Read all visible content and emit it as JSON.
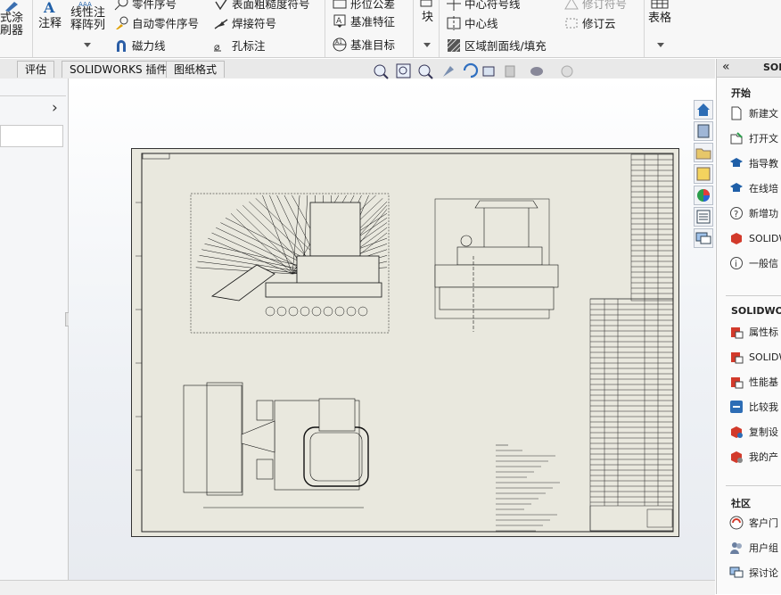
{
  "ribbon": {
    "col1_line1": "式涂",
    "col1_line2": "刷器",
    "annotate": "注释",
    "linear_pattern_line1": "线性注",
    "linear_pattern_line2": "释阵列",
    "part_no_partial": "零件序号",
    "auto_balloon": "自动零件序号",
    "magnetic_line": "磁力线",
    "surface_finish_partial": "表面粗糙度符号",
    "weld_symbol": "焊接符号",
    "hole_callout": "孔标注",
    "geo_tolerance_partial": "形位公差",
    "datum_feature": "基准特征",
    "datum_target": "基准目标",
    "block": "块",
    "center_mark_partial": "中心符号线",
    "centerline": "中心线",
    "hatch_fill": "区域剖面线/填充",
    "rev_symbol_partial": "修订符号",
    "rev_cloud": "修订云",
    "tables": "表格"
  },
  "tabs": [
    "评估",
    "SOLIDWORKS 插件",
    "图纸格式"
  ],
  "left_panel": {
    "expand_arrow": "›"
  },
  "taskpane": {
    "title": "SOL",
    "collapse": "«",
    "sections": [
      {
        "heading": "开始",
        "items": [
          "新建文",
          "打开文",
          "指导教",
          "在线培",
          "新增功",
          "SOLIDW",
          "一般信"
        ]
      },
      {
        "heading": "SOLIDWOR",
        "items": [
          "属性标",
          "SOLIDW",
          "性能基",
          "比较我",
          "复制设",
          "我的产"
        ]
      },
      {
        "heading": "社区",
        "items": [
          "客户门",
          "用户组",
          "探讨论"
        ]
      }
    ]
  },
  "colors": {
    "accent": "#1f5fa8",
    "sheet": "#e9e8de",
    "ribbon": "#f7f7f7"
  }
}
